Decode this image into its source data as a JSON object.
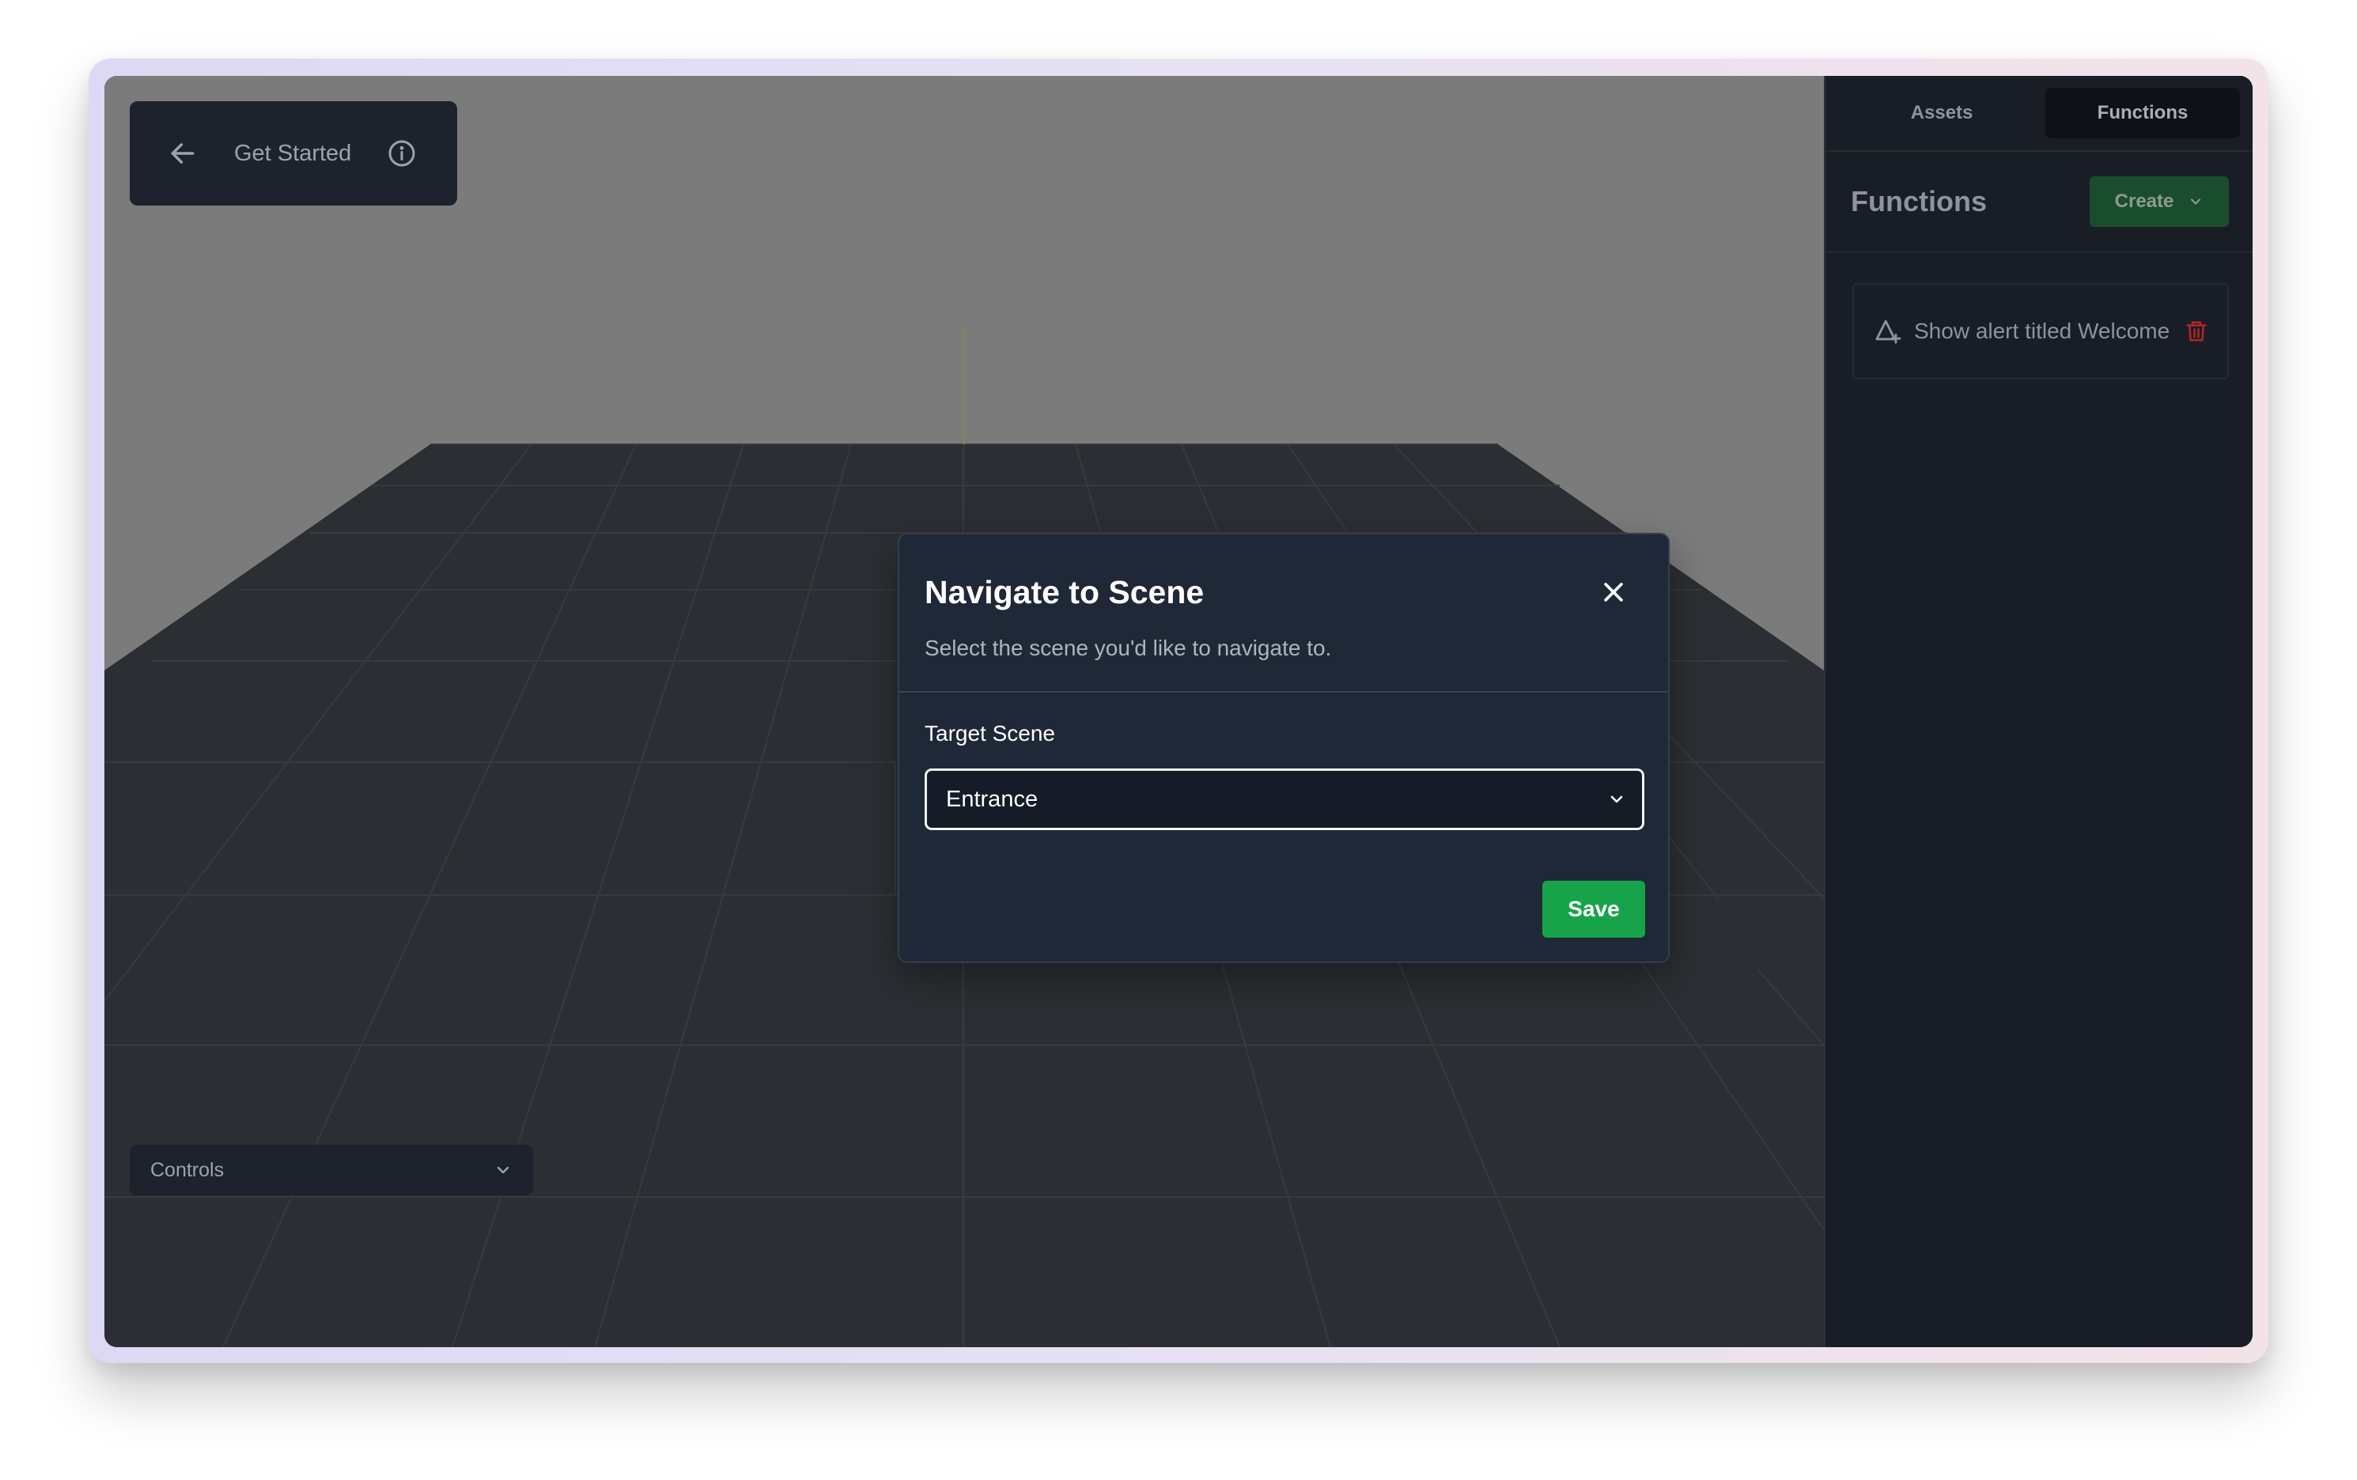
{
  "header": {
    "title": "Get Started",
    "icons": {
      "back": "arrow-left-icon",
      "info": "info-circle-icon"
    }
  },
  "controls": {
    "label": "Controls",
    "icon": "chevron-down-icon"
  },
  "panel": {
    "tabs": [
      {
        "label": "Assets",
        "active": false
      },
      {
        "label": "Functions",
        "active": true
      }
    ],
    "title": "Functions",
    "create_label": "Create",
    "functions": [
      {
        "label": "Show alert titled Welcome",
        "icon": "alert-triangle-icon",
        "delete_icon": "trash-icon"
      }
    ]
  },
  "modal": {
    "title": "Navigate to Scene",
    "subtitle": "Select the scene you'd like to navigate to.",
    "field_label": "Target Scene",
    "selected_scene": "Entrance",
    "save_label": "Save"
  },
  "colors": {
    "viewport_bg": "#7b7b7b",
    "floor": "#2b2f33",
    "panel_bg": "#191d25",
    "modal_bg": "#1f2837",
    "save_green": "#17a34a",
    "create_green": "#1a4d2e",
    "delete_red": "#b32626"
  }
}
